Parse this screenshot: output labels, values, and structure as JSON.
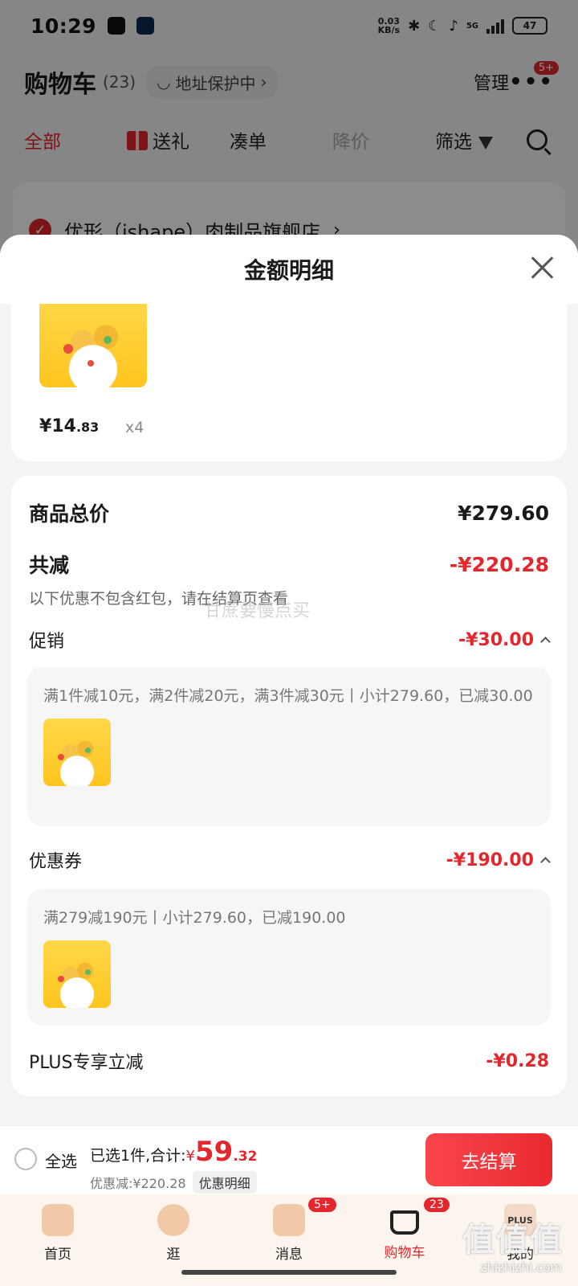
{
  "status_bar": {
    "time": "10:29",
    "net_speed": "0.03",
    "net_unit": "KB/s",
    "net_type": "5G",
    "battery": "47"
  },
  "header": {
    "title": "购物车",
    "count": "(23)",
    "address": "地址保护中",
    "manage": "管理",
    "more_badge": "5+"
  },
  "tabs": [
    {
      "label": "全部",
      "state": "active"
    },
    {
      "label": "送礼",
      "icon": "gift-icon"
    },
    {
      "label": "凑单"
    },
    {
      "label": "降价",
      "state": "dim"
    },
    {
      "label": "筛选",
      "icon": "filter-icon"
    }
  ],
  "store": {
    "name": "优形（ishape）肉制品旗舰店"
  },
  "sheet": {
    "title": "金额明细",
    "peek_item": {
      "price_sym": "¥",
      "price_int": "14",
      "price_dec": ".83",
      "qty": "x4"
    },
    "summary": {
      "total_label": "商品总价",
      "total_value": "¥279.60",
      "reduce_label": "共减",
      "reduce_value": "-¥220.28",
      "note": "以下优惠不包含红包，请在结算页查看",
      "watermark": "甘蔗要慢点买"
    },
    "promo": {
      "label": "促销",
      "value": "-¥30.00",
      "detail": "满1件减10元，满2件减20元，满3件减30元丨小计279.60，已减30.00"
    },
    "coupon": {
      "label": "优惠券",
      "value": "-¥190.00",
      "detail": "满279减190元丨小计279.60，已减190.00"
    },
    "plus": {
      "label": "PLUS专享立减",
      "value": "-¥0.28"
    }
  },
  "checkout": {
    "select_all": "全选",
    "selected_info": "已选1件,合计:",
    "total_sym": "¥",
    "total_int": "59",
    "total_dec": ".32",
    "discount": "优惠减:¥220.28",
    "detail_button": "优惠明细",
    "pay_button": "去结算"
  },
  "bottom_nav": [
    {
      "label": "首页",
      "icon": "home-icon"
    },
    {
      "label": "逛",
      "icon": "face-icon"
    },
    {
      "label": "消息",
      "icon": "message-icon",
      "badge": "5+"
    },
    {
      "label": "购物车",
      "icon": "cart-icon",
      "badge": "23",
      "state": "active"
    },
    {
      "label": "我的",
      "icon": "plus-member-icon",
      "icon_text": "PLUS"
    }
  ],
  "watermark_site": {
    "mark": "值值值",
    "url": "zhizhizhi.com"
  },
  "colors": {
    "accent": "#e4262d",
    "sheet_bg": "#f4f4f4",
    "card_bg": "#ffffff"
  }
}
